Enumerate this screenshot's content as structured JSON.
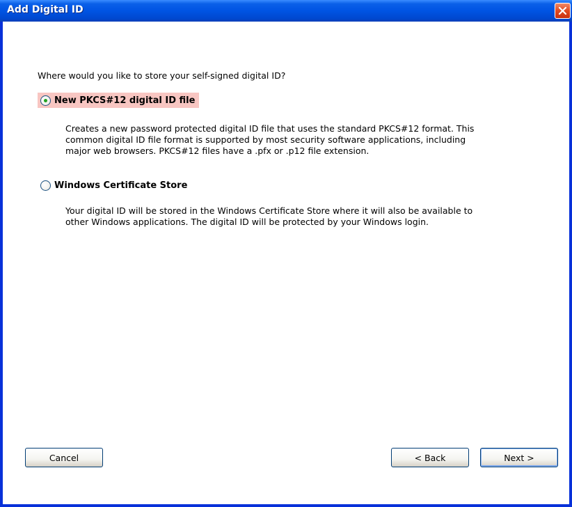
{
  "window": {
    "title": "Add Digital ID",
    "close_icon": "close-icon"
  },
  "content": {
    "question": "Where would you like to store your self-signed digital ID?",
    "options": [
      {
        "label": "New PKCS#12 digital ID file",
        "selected": true,
        "description_lines": [
          "Creates a new password protected digital ID file that uses the standard PKCS#12 format. This",
          "common digital ID file format is supported by most security software applications, including",
          "major web browsers. PKCS#12 files have a .pfx or .p12 file extension."
        ]
      },
      {
        "label": "Windows Certificate Store",
        "selected": false,
        "description_lines": [
          "Your digital ID will be stored in the Windows Certificate Store where it will also be available to",
          "other Windows applications. The digital ID will be protected by your Windows login."
        ]
      }
    ]
  },
  "buttons": {
    "cancel": "Cancel",
    "back": "< Back",
    "next": "Next >"
  },
  "colors": {
    "titlebar": "#0054e3",
    "selection_highlight": "#f8c6c2",
    "radio_dot": "#21a121"
  }
}
